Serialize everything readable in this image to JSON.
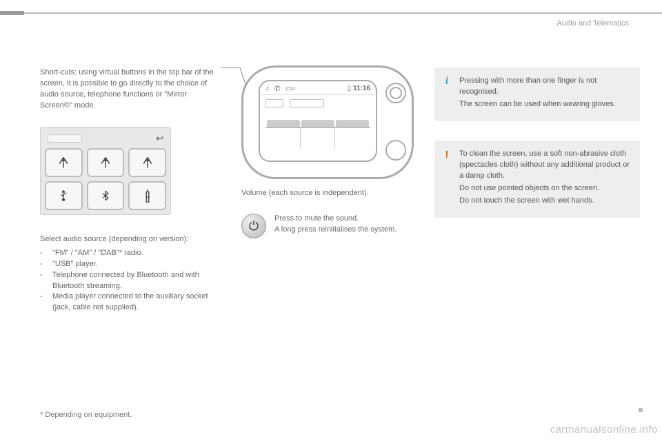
{
  "header": {
    "section": "Audio and Telematics"
  },
  "left": {
    "shortcuts_para": "Short-cuts: using virtual buttons in the top bar of the screen, it is possible to go directly to the choice of audio source, telephone functions or \"Mirror Screen®\" mode.",
    "source_heading": "Select audio source (depending on version):",
    "sources": [
      "\"FM\" / \"AM\" / \"DAB\"* radio.",
      "\"USB\" player.",
      "Telephone connected by Bluetooth and with Bluetooth streaming.",
      "Media player connected to the auxiliary socket (jack, cable not supplied)."
    ],
    "icons": {
      "r1c1": "antenna-icon",
      "r1c2": "antenna-icon",
      "r1c3": "antenna-icon",
      "r2c1": "usb-icon",
      "r2c2": "bluetooth-icon",
      "r2c3": "jack-icon"
    }
  },
  "mid": {
    "clock": "11:16",
    "volume_caption": "Volume (each source is independent).",
    "mute_line1": "Press to mute the sound.",
    "mute_line2": "A long press reinitialises the system."
  },
  "right": {
    "info_p1": "Pressing with more than one finger is not recognised.",
    "info_p2": "The screen can be used when wearing gloves.",
    "warn_p1": "To clean the screen, use a soft non-abrasive cloth (spectacles cloth) without any additional product or a damp cloth.",
    "warn_p2": "Do not use pointed objects on the screen.",
    "warn_p3": "Do not touch the screen with wet hands."
  },
  "footnote": "* Depending on equipment.",
  "watermark": "carmanualsonline.info"
}
